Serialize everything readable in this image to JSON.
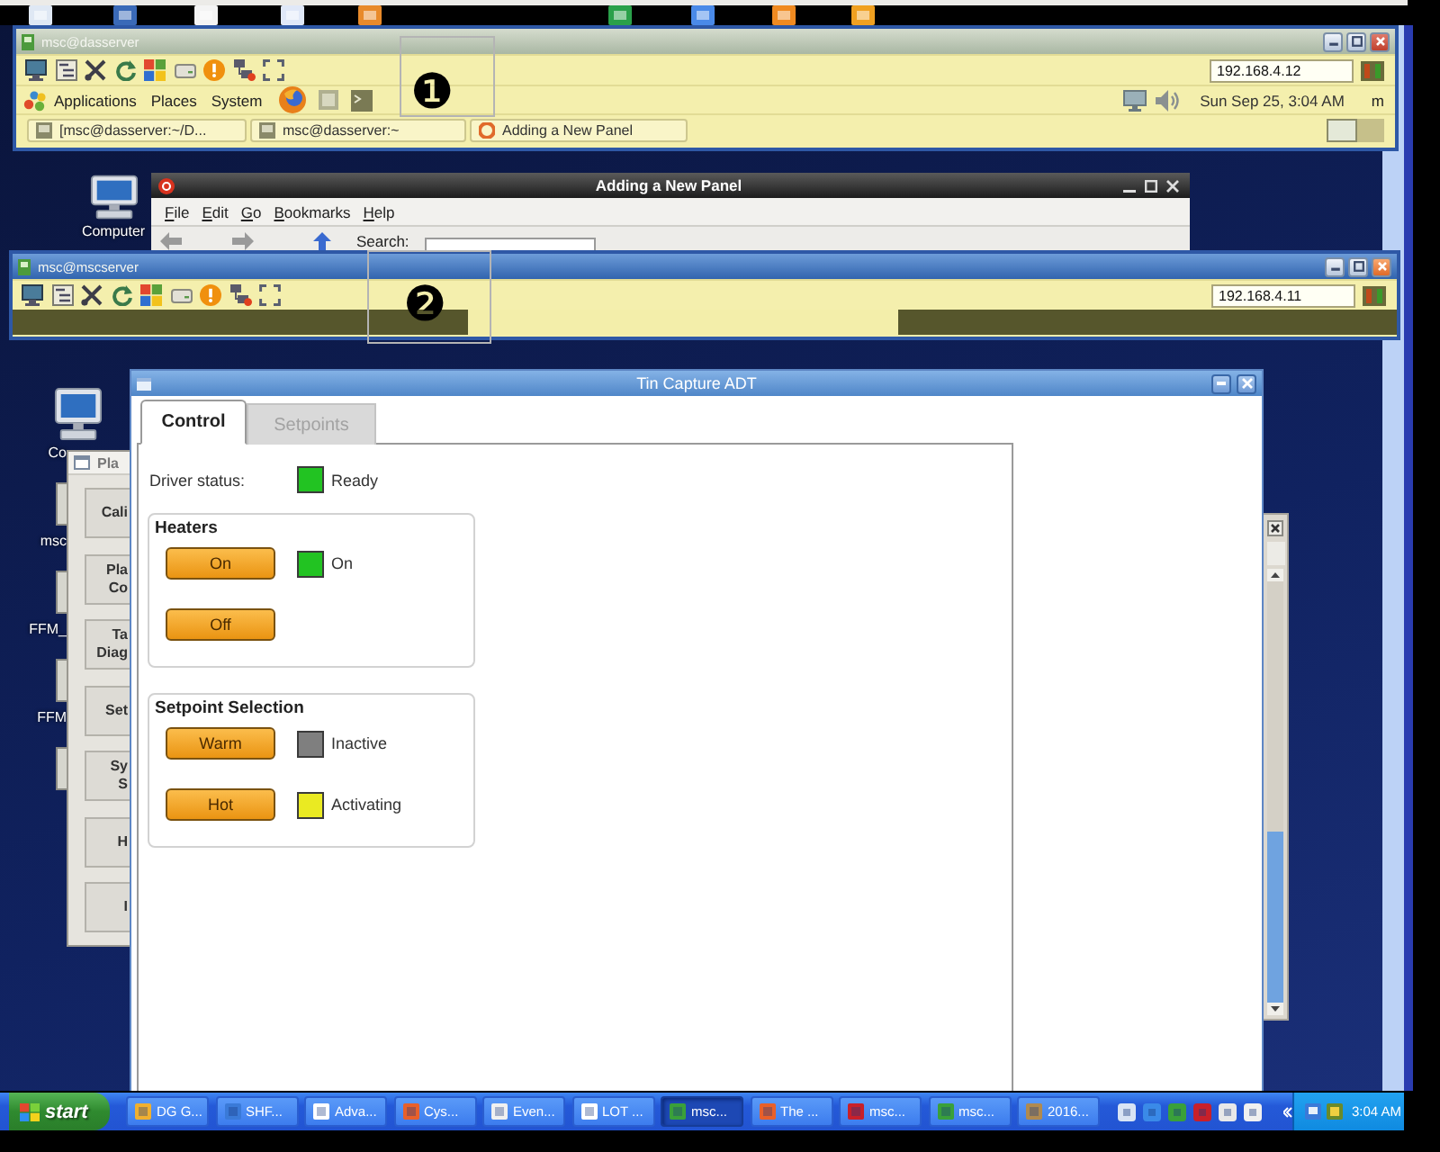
{
  "session_1": {
    "title": "msc@dasserver",
    "active": false,
    "menus": [
      "Applications",
      "Places",
      "System"
    ],
    "address": "192.168.4.12",
    "clock": "Sun Sep 25, 3:04 AM",
    "user": "m",
    "tasks": [
      {
        "label": "[msc@dasserver:~/D...",
        "kind": "terminal"
      },
      {
        "label": "msc@dasserver:~",
        "kind": "terminal"
      },
      {
        "label": "Adding a New Panel",
        "kind": "help"
      }
    ],
    "callout": "❶"
  },
  "desktop_1": {
    "icons": [
      {
        "kind": "computer",
        "label": "Computer"
      }
    ]
  },
  "file_browser": {
    "title": "Adding a New Panel",
    "menus": [
      "File",
      "Edit",
      "Go",
      "Bookmarks",
      "Help"
    ],
    "search_label": "Search:"
  },
  "session_2": {
    "title": "msc@mscserver",
    "active": true,
    "address": "192.168.4.11",
    "callout": "❷"
  },
  "desktop_2": {
    "icons": [
      {
        "kind": "computer",
        "label": "Co"
      },
      {
        "kind": "file",
        "label": "msc"
      },
      {
        "kind": "file",
        "label": "FFM_"
      },
      {
        "kind": "file",
        "label": "FFM"
      },
      {
        "kind": "file"
      }
    ]
  },
  "pla_window": {
    "title": "Pla",
    "buttons": [
      "Cali",
      "Pla\nCo",
      "Ta\nDiag",
      "Set",
      "Sy\nS",
      "H",
      "I"
    ]
  },
  "tin_capture": {
    "title": "Tin Capture ADT",
    "tabs": [
      {
        "label": "Control",
        "selected": true
      },
      {
        "label": "Setpoints",
        "selected": false
      }
    ],
    "status": {
      "label": "Driver status:",
      "color": "#22c322",
      "text": "Ready"
    },
    "groups": [
      {
        "title": "Heaters",
        "rows": [
          {
            "button": "On",
            "indicator": {
              "color": "#22c322",
              "label": "On"
            }
          },
          {
            "button": "Off"
          }
        ]
      },
      {
        "title": "Setpoint Selection",
        "rows": [
          {
            "button": "Warm",
            "indicator": {
              "color": "#7f7f7f",
              "label": "Inactive"
            }
          },
          {
            "button": "Hot",
            "indicator": {
              "color": "#eaea22",
              "label": "Activating"
            }
          }
        ]
      }
    ]
  },
  "taskbar": {
    "start": "start",
    "tasks": [
      {
        "label": "DG G...",
        "selected": false
      },
      {
        "label": "SHF...",
        "selected": false
      },
      {
        "label": "Adva...",
        "selected": false
      },
      {
        "label": "Cys...",
        "selected": false
      },
      {
        "label": "Even...",
        "selected": false
      },
      {
        "label": "LOT ...",
        "selected": false
      },
      {
        "label": "msc...",
        "selected": true
      },
      {
        "label": "The ...",
        "selected": false
      },
      {
        "label": "msc...",
        "selected": false
      },
      {
        "label": "msc...",
        "selected": false
      },
      {
        "label": "2016...",
        "selected": false
      }
    ],
    "clock": "3:04 AM"
  }
}
